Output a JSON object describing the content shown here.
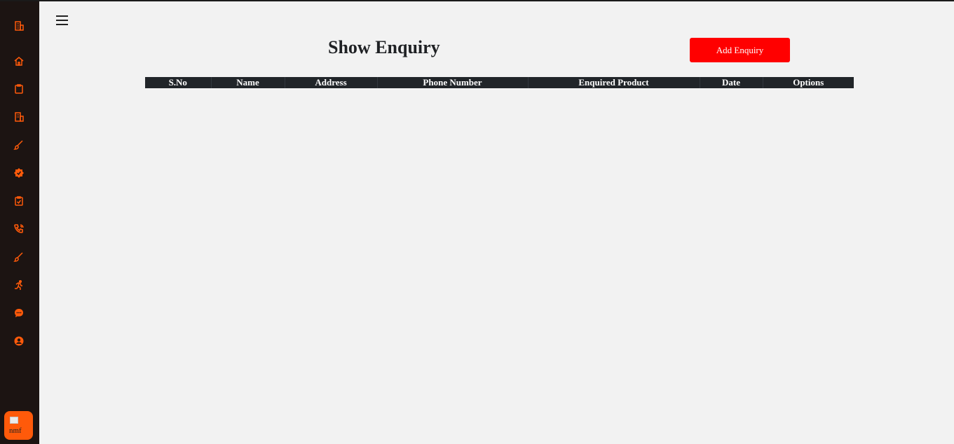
{
  "sidebar": {
    "icon_color": "#ff5a0a",
    "items": [
      {
        "name": "building-icon"
      },
      {
        "name": "home-icon"
      },
      {
        "name": "clipboard-icon"
      },
      {
        "name": "building-icon"
      },
      {
        "name": "brush-icon"
      },
      {
        "name": "badge-check-icon"
      },
      {
        "name": "clipboard-check-icon"
      },
      {
        "name": "phone-icon"
      },
      {
        "name": "brush-icon"
      },
      {
        "name": "running-person-icon"
      },
      {
        "name": "chat-icon"
      },
      {
        "name": "user-circle-icon"
      }
    ],
    "profile_alt": "nmf"
  },
  "header": {
    "menu_icon": "hamburger-icon"
  },
  "page": {
    "title": "Show Enquiry",
    "add_button": "Add Enquiry",
    "accent_color": "#ff0000"
  },
  "table": {
    "columns": [
      "S.No",
      "Name",
      "Address",
      "Phone Number",
      "Enquired Product",
      "Date",
      "Options"
    ],
    "rows": []
  }
}
